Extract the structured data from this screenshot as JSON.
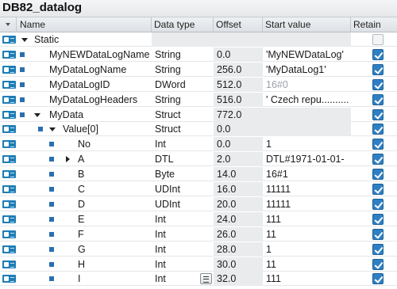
{
  "title": "DB82_datalog",
  "columns": {
    "name": "Name",
    "data_type": "Data type",
    "offset": "Offset",
    "start_value": "Start value",
    "retain": "Retain"
  },
  "rows": [
    {
      "name": "Static",
      "data_type": "",
      "offset": "",
      "start_value": "",
      "retain": "disabled",
      "expander": "down",
      "bullet": false
    },
    {
      "name": "MyNEWDataLogName",
      "data_type": "String",
      "offset": "0.0",
      "start_value": "'MyNEWDataLog'",
      "retain": "checked",
      "expander": "none",
      "bullet": true
    },
    {
      "name": "MyDataLogName",
      "data_type": "String",
      "offset": "256.0",
      "start_value": "'MyDataLog1'",
      "retain": "checked",
      "expander": "none",
      "bullet": true
    },
    {
      "name": "MyDataLogID",
      "data_type": "DWord",
      "offset": "512.0",
      "start_value": "16#0",
      "retain": "checked",
      "expander": "none",
      "bullet": true
    },
    {
      "name": "MyDataLogHeaders",
      "data_type": "String",
      "offset": "516.0",
      "start_value": "' Czech repu..........",
      "retain": "checked",
      "expander": "none",
      "bullet": true
    },
    {
      "name": "MyData",
      "data_type": "Struct",
      "offset": "772.0",
      "start_value": "",
      "retain": "checked",
      "expander": "down",
      "bullet": true
    },
    {
      "name": "Value[0]",
      "data_type": "Struct",
      "offset": "0.0",
      "start_value": "",
      "retain": "checked",
      "expander": "down",
      "bullet": true
    },
    {
      "name": "No",
      "data_type": "Int",
      "offset": "0.0",
      "start_value": "1",
      "retain": "checked",
      "expander": "none",
      "bullet": true
    },
    {
      "name": "A",
      "data_type": "DTL",
      "offset": "2.0",
      "start_value": "DTL#1971-01-01-",
      "retain": "checked",
      "expander": "right",
      "bullet": true
    },
    {
      "name": "B",
      "data_type": "Byte",
      "offset": "14.0",
      "start_value": "16#1",
      "retain": "checked",
      "expander": "none",
      "bullet": true
    },
    {
      "name": "C",
      "data_type": "UDInt",
      "offset": "16.0",
      "start_value": "11111",
      "retain": "checked",
      "expander": "none",
      "bullet": true
    },
    {
      "name": "D",
      "data_type": "UDInt",
      "offset": "20.0",
      "start_value": "11111",
      "retain": "checked",
      "expander": "none",
      "bullet": true
    },
    {
      "name": "E",
      "data_type": "Int",
      "offset": "24.0",
      "start_value": "111",
      "retain": "checked",
      "expander": "none",
      "bullet": true
    },
    {
      "name": "F",
      "data_type": "Int",
      "offset": "26.0",
      "start_value": "11",
      "retain": "checked",
      "expander": "none",
      "bullet": true
    },
    {
      "name": "G",
      "data_type": "Int",
      "offset": "28.0",
      "start_value": "1",
      "retain": "checked",
      "expander": "none",
      "bullet": true
    },
    {
      "name": "H",
      "data_type": "Int",
      "offset": "30.0",
      "start_value": "11",
      "retain": "checked",
      "expander": "none",
      "bullet": true
    },
    {
      "name": "I",
      "data_type": "Int",
      "offset": "32.0",
      "start_value": "111",
      "retain": "checked",
      "expander": "none",
      "bullet": true
    }
  ],
  "icons": {
    "row_icon": "interface-icon",
    "member_icon": "bullet-icon",
    "list_button": "list-picker-icon"
  },
  "colors": {
    "accent": "#2f7fc4",
    "icon_blue": "#1f7db5",
    "grey_value": "#9aa0a6"
  }
}
